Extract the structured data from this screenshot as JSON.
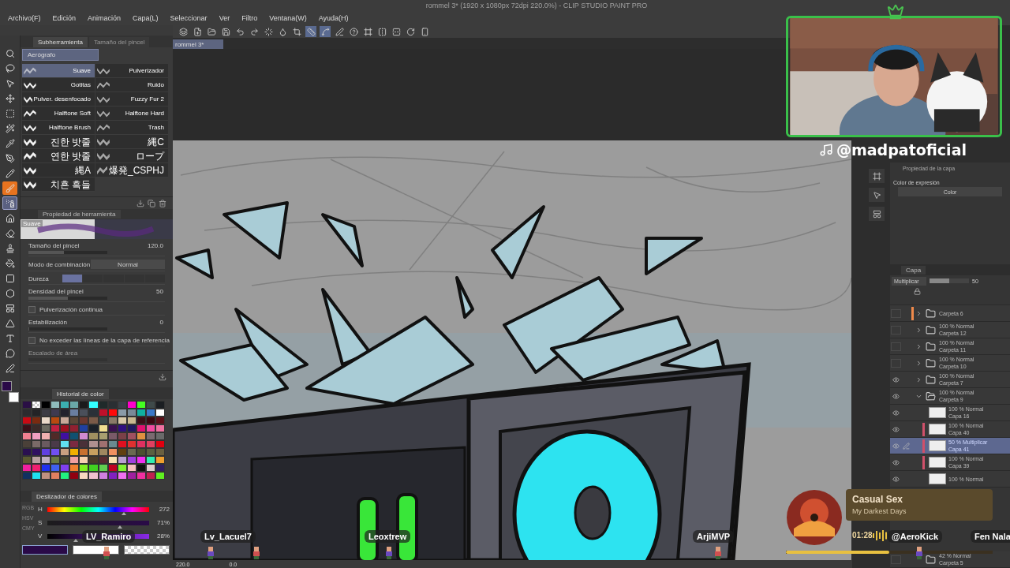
{
  "window": {
    "title": "rommel 3* (1920 x 1080px 72dpi 220.0%) - CLIP STUDIO PAINT PRO"
  },
  "menu": [
    "Archivo(F)",
    "Edición",
    "Animación",
    "Capa(L)",
    "Seleccionar",
    "Ver",
    "Filtro",
    "Ventana(W)",
    "Ayuda(H)"
  ],
  "command_bar": [
    {
      "kind": "app",
      "on": false
    },
    {
      "kind": "new",
      "on": false
    },
    {
      "kind": "open",
      "on": false
    },
    {
      "kind": "save",
      "on": false
    },
    {
      "kind": "undo",
      "on": false
    },
    {
      "kind": "redo",
      "on": false
    },
    {
      "kind": "loading",
      "on": false
    },
    {
      "kind": "fill",
      "on": false
    },
    {
      "kind": "crop",
      "on": false
    },
    {
      "kind": "ruler",
      "on": true
    },
    {
      "kind": "curve",
      "on": true
    },
    {
      "kind": "pen",
      "on": false
    },
    {
      "kind": "help",
      "on": false
    },
    {
      "kind": "frame",
      "on": false
    },
    {
      "kind": "flip",
      "on": false
    },
    {
      "kind": "flipv",
      "on": false
    },
    {
      "kind": "rotate",
      "on": false
    },
    {
      "kind": "phone",
      "on": false
    }
  ],
  "document_tab": {
    "label": "rommel 3*"
  },
  "tools": [
    {
      "kind": "search",
      "selected": false,
      "active": false
    },
    {
      "kind": "lasso",
      "selected": false,
      "active": false
    },
    {
      "kind": "pointer",
      "selected": false,
      "active": false
    },
    {
      "kind": "move",
      "selected": false,
      "active": false
    },
    {
      "kind": "select",
      "selected": false,
      "active": false
    },
    {
      "kind": "wand",
      "selected": false,
      "active": false
    },
    {
      "kind": "pipette",
      "selected": false,
      "active": false
    },
    {
      "kind": "pen",
      "selected": false,
      "active": false
    },
    {
      "kind": "pencil",
      "selected": false,
      "active": false
    },
    {
      "kind": "brush",
      "selected": false,
      "active": true
    },
    {
      "kind": "spray",
      "selected": true,
      "active": false
    },
    {
      "kind": "home",
      "selected": false,
      "active": false
    },
    {
      "kind": "eraser",
      "selected": false,
      "active": false
    },
    {
      "kind": "stamp",
      "selected": false,
      "active": false
    },
    {
      "kind": "bucket",
      "selected": false,
      "active": false
    },
    {
      "kind": "gradient",
      "selected": false,
      "active": false
    },
    {
      "kind": "shape",
      "selected": false,
      "active": false
    },
    {
      "kind": "panel",
      "selected": false,
      "active": false
    },
    {
      "kind": "ruler",
      "selected": false,
      "active": false
    },
    {
      "kind": "text",
      "selected": false,
      "active": false
    },
    {
      "kind": "balloon",
      "selected": false,
      "active": false
    },
    {
      "kind": "line",
      "selected": false,
      "active": false
    }
  ],
  "tool_colors": [
    {
      "kind": "main",
      "color": "#2a0a48"
    },
    {
      "kind": "sub",
      "color": "#ffffff"
    }
  ],
  "subtool_panel": {
    "tabs": [
      {
        "label": "Subherramienta",
        "selected": true
      },
      {
        "label": "Tamaño del pincel",
        "selected": false
      }
    ],
    "group": "Aerógrafo",
    "brushes": [
      {
        "label": "Suave",
        "selected": true
      },
      {
        "label": "Pulverizador",
        "selected": false
      },
      {
        "label": "Gotitas",
        "selected": false
      },
      {
        "label": "Ruido",
        "selected": false
      },
      {
        "label": "Pulver. desenfocado",
        "selected": false
      },
      {
        "label": "Fuzzy Fur 2",
        "selected": false
      },
      {
        "label": "Halftone Soft",
        "selected": false
      },
      {
        "label": "Halftone Hard",
        "selected": false
      },
      {
        "label": "Halftone Brush",
        "selected": false
      },
      {
        "label": "Trash",
        "selected": false
      },
      {
        "label": "진한 밧줄",
        "selected": false
      },
      {
        "label": "縄C",
        "selected": false
      },
      {
        "label": "연한 밧줄",
        "selected": false
      },
      {
        "label": "ロープ",
        "selected": false
      },
      {
        "label": "縄A",
        "selected": false
      },
      {
        "label": "爆発_CSPHJ",
        "selected": false
      },
      {
        "label": "치흔 흑들",
        "selected": false
      }
    ]
  },
  "tool_property": {
    "title": "Propiedad de herramienta",
    "preview_label": "Suave",
    "rows": [
      {
        "kind": "slider",
        "label": "Tamaño del pincel",
        "value": "120.0",
        "level": 0.45
      },
      {
        "kind": "select",
        "label": "Modo de combinación",
        "value": "Normal"
      },
      {
        "kind": "segments",
        "label": "Dureza",
        "level": 0.2
      },
      {
        "kind": "slider",
        "label": "Densidad del pincel",
        "value": "50",
        "level": 0.5
      },
      {
        "kind": "checkbox",
        "label": "Pulverización continua",
        "checked": false
      },
      {
        "kind": "slider",
        "label": "Estabilización",
        "value": "0",
        "level": 0
      },
      {
        "kind": "checkbox",
        "label": "No exceder las líneas de la capa de referencia",
        "checked": false
      },
      {
        "kind": "disabled",
        "label": "Escalado de área"
      }
    ]
  },
  "color_history": {
    "title": "Historial de color",
    "rows": [
      [
        {
          "kind": "solid",
          "color": "#2a0f45"
        },
        {
          "kind": "transparent"
        },
        {
          "kind": "solid",
          "color": "#000000"
        },
        {
          "kind": "solid",
          "color": "#8fbcbc"
        },
        {
          "kind": "solid",
          "color": "#3bb0b0"
        },
        {
          "kind": "solid",
          "color": "#6aa8a8"
        },
        {
          "kind": "solid",
          "color": "#1b1b1b"
        },
        {
          "kind": "solid",
          "color": "#33ffff"
        },
        {
          "kind": "solid",
          "color": "#1f2a2a"
        },
        {
          "kind": "solid",
          "color": "#2a2f33"
        },
        {
          "kind": "solid",
          "color": "#3a4048"
        },
        {
          "kind": "solid",
          "color": "#ff00cc"
        },
        {
          "kind": "solid",
          "color": "#44ff22"
        },
        {
          "kind": "solid",
          "color": "#3f4a4a"
        },
        {
          "kind": "solid",
          "color": "#1b1e22"
        }
      ],
      [
        {
          "kind": "solid",
          "color": "#2b2b2e"
        },
        {
          "kind": "solid",
          "color": "#232326"
        },
        {
          "kind": "solid",
          "color": "#3c3c44"
        },
        {
          "kind": "solid",
          "color": "#3f3a50"
        },
        {
          "kind": "solid",
          "color": "#22222c"
        },
        {
          "kind": "solid",
          "color": "#6a7fa0"
        },
        {
          "kind": "solid",
          "color": "#4a4f5a"
        },
        {
          "kind": "solid",
          "color": "#2a3038"
        },
        {
          "kind": "solid",
          "color": "#c0102a"
        },
        {
          "kind": "solid",
          "color": "#ff0a0a"
        },
        {
          "kind": "solid",
          "color": "#8a9aa8"
        },
        {
          "kind": "solid",
          "color": "#7a8a98"
        },
        {
          "kind": "solid",
          "color": "#10b0a0"
        },
        {
          "kind": "solid",
          "color": "#3a78c8"
        },
        {
          "kind": "solid",
          "color": "#ffffff"
        }
      ],
      [
        {
          "kind": "solid",
          "color": "#c80a14"
        },
        {
          "kind": "solid",
          "color": "#7a2a10"
        },
        {
          "kind": "solid",
          "color": "#e8d8c8"
        },
        {
          "kind": "solid",
          "color": "#b84a10"
        },
        {
          "kind": "solid",
          "color": "#c8a898"
        },
        {
          "kind": "solid",
          "color": "#5a4838"
        },
        {
          "kind": "solid",
          "color": "#6a3830"
        },
        {
          "kind": "solid",
          "color": "#7a5a48"
        },
        {
          "kind": "solid",
          "color": "#3a4a48"
        },
        {
          "kind": "solid",
          "color": "#8a7a68"
        },
        {
          "kind": "solid",
          "color": "#d8c8a8"
        },
        {
          "kind": "solid",
          "color": "#c8b890"
        },
        {
          "kind": "solid",
          "color": "#3a1018"
        },
        {
          "kind": "solid",
          "color": "#3a0810"
        },
        {
          "kind": "solid",
          "color": "#5a1018"
        }
      ],
      [
        {
          "kind": "solid",
          "color": "#3a1018"
        },
        {
          "kind": "solid",
          "color": "#3a2a28"
        },
        {
          "kind": "solid",
          "color": "#6a6a60"
        },
        {
          "kind": "solid",
          "color": "#c02040"
        },
        {
          "kind": "solid",
          "color": "#a01020"
        },
        {
          "kind": "solid",
          "color": "#902030"
        },
        {
          "kind": "solid",
          "color": "#2040a0"
        },
        {
          "kind": "solid",
          "color": "#1a2028"
        },
        {
          "kind": "solid",
          "color": "#f0e090"
        },
        {
          "kind": "solid",
          "color": "#3a1050"
        },
        {
          "kind": "solid",
          "color": "#301080"
        },
        {
          "kind": "solid",
          "color": "#201860"
        },
        {
          "kind": "solid",
          "color": "#e01070"
        },
        {
          "kind": "solid",
          "color": "#f04aa0"
        },
        {
          "kind": "solid",
          "color": "#f070a0"
        }
      ],
      [
        {
          "kind": "solid",
          "color": "#f08090"
        },
        {
          "kind": "solid",
          "color": "#f0a0c0"
        },
        {
          "kind": "solid",
          "color": "#f0b0b0"
        },
        {
          "kind": "solid",
          "color": "#502a28"
        },
        {
          "kind": "solid",
          "color": "#4010a0"
        },
        {
          "kind": "solid",
          "color": "#105070"
        },
        {
          "kind": "solid",
          "color": "#d08ad0"
        },
        {
          "kind": "solid",
          "color": "#a09060"
        },
        {
          "kind": "solid",
          "color": "#a8a070"
        },
        {
          "kind": "solid",
          "color": "#7a5a68"
        },
        {
          "kind": "solid",
          "color": "#7a4048"
        },
        {
          "kind": "solid",
          "color": "#a05060"
        },
        {
          "kind": "solid",
          "color": "#e09040"
        },
        {
          "kind": "solid",
          "color": "#7a6a70"
        },
        {
          "kind": "solid",
          "color": "#6a6a6a"
        }
      ],
      [
        {
          "kind": "solid",
          "color": "#4a4038"
        },
        {
          "kind": "solid",
          "color": "#7a6a68"
        },
        {
          "kind": "solid",
          "color": "#6a5a60"
        },
        {
          "kind": "solid",
          "color": "#4a3a48"
        },
        {
          "kind": "solid",
          "color": "#60e0f0"
        },
        {
          "kind": "solid",
          "color": "#7a2a40"
        },
        {
          "kind": "solid",
          "color": "#4a3038"
        },
        {
          "kind": "solid",
          "color": "#b09090"
        },
        {
          "kind": "solid",
          "color": "#a07070"
        },
        {
          "kind": "solid",
          "color": "#6a8a90"
        },
        {
          "kind": "solid",
          "color": "#e01020"
        },
        {
          "kind": "solid",
          "color": "#e03030"
        },
        {
          "kind": "solid",
          "color": "#e03060"
        },
        {
          "kind": "solid",
          "color": "#e04060"
        },
        {
          "kind": "solid",
          "color": "#e00010"
        }
      ],
      [
        {
          "kind": "solid",
          "color": "#2a1050"
        },
        {
          "kind": "solid",
          "color": "#301060"
        },
        {
          "kind": "solid",
          "color": "#6040e0"
        },
        {
          "kind": "solid",
          "color": "#7050f0"
        },
        {
          "kind": "solid",
          "color": "#c8a080"
        },
        {
          "kind": "solid",
          "color": "#f0b000"
        },
        {
          "kind": "solid",
          "color": "#c87030"
        },
        {
          "kind": "solid",
          "color": "#c8a060"
        },
        {
          "kind": "solid",
          "color": "#a08860"
        },
        {
          "kind": "solid",
          "color": "#f09060"
        },
        {
          "kind": "solid",
          "color": "#604010"
        },
        {
          "kind": "solid",
          "color": "#6a6a50"
        },
        {
          "kind": "solid",
          "color": "#4a5030"
        },
        {
          "kind": "solid",
          "color": "#5a6040"
        },
        {
          "kind": "solid",
          "color": "#6a6040"
        }
      ],
      [
        {
          "kind": "solid",
          "color": "#5a5a30"
        },
        {
          "kind": "solid",
          "color": "#b8a0a0"
        },
        {
          "kind": "solid",
          "color": "#c0b0c0"
        },
        {
          "kind": "solid",
          "color": "#6a7a40"
        },
        {
          "kind": "solid",
          "color": "#4a4a30"
        },
        {
          "kind": "solid",
          "color": "#f0a0a0"
        },
        {
          "kind": "solid",
          "color": "#f8d0b0"
        },
        {
          "kind": "solid",
          "color": "#4a3a28"
        },
        {
          "kind": "solid",
          "color": "#5a2a30"
        },
        {
          "kind": "solid",
          "color": "#f8e0b0"
        },
        {
          "kind": "solid",
          "color": "#b8a0d0"
        },
        {
          "kind": "solid",
          "color": "#a040e0"
        },
        {
          "kind": "solid",
          "color": "#f030f0"
        },
        {
          "kind": "solid",
          "color": "#30f0b0"
        },
        {
          "kind": "solid",
          "color": "#f0a030"
        }
      ],
      [
        {
          "kind": "solid",
          "color": "#f020a0"
        },
        {
          "kind": "solid",
          "color": "#f02070"
        },
        {
          "kind": "solid",
          "color": "#2030f0"
        },
        {
          "kind": "solid",
          "color": "#4060f0"
        },
        {
          "kind": "solid",
          "color": "#8040f0"
        },
        {
          "kind": "solid",
          "color": "#f08030"
        },
        {
          "kind": "solid",
          "color": "#80f020"
        },
        {
          "kind": "solid",
          "color": "#40d020"
        },
        {
          "kind": "solid",
          "color": "#60d050"
        },
        {
          "kind": "solid",
          "color": "#c00020"
        },
        {
          "kind": "solid",
          "color": "#80f030"
        },
        {
          "kind": "solid",
          "color": "#f8c0c0"
        },
        {
          "kind": "solid",
          "color": "#101010"
        },
        {
          "kind": "solid",
          "color": "#e0d0d0"
        },
        {
          "kind": "solid",
          "color": "#302060"
        }
      ],
      [
        {
          "kind": "solid",
          "color": "#103060"
        },
        {
          "kind": "solid",
          "color": "#20e0f0"
        },
        {
          "kind": "solid",
          "color": "#c09080"
        },
        {
          "kind": "solid",
          "color": "#e08060"
        },
        {
          "kind": "solid",
          "color": "#20f080"
        },
        {
          "kind": "solid",
          "color": "#900010"
        },
        {
          "kind": "solid",
          "color": "#f8d8c0"
        },
        {
          "kind": "solid",
          "color": "#f0c0d0"
        },
        {
          "kind": "solid",
          "color": "#d080e0"
        },
        {
          "kind": "solid",
          "color": "#8020c0"
        },
        {
          "kind": "solid",
          "color": "#f070f0"
        },
        {
          "kind": "solid",
          "color": "#a020a0"
        },
        {
          "kind": "solid",
          "color": "#f030a0"
        },
        {
          "kind": "solid",
          "color": "#c02050"
        },
        {
          "kind": "solid",
          "color": "#60f020"
        }
      ]
    ]
  },
  "color_slider": {
    "title": "Deslizador de colores",
    "modes": [
      "RGB",
      "HSV",
      "CMY"
    ],
    "channels": [
      {
        "kind": "hue",
        "label": "H",
        "value": "272",
        "level": 0.75
      },
      {
        "kind": "saturation",
        "label": "S",
        "value": "71%",
        "level": 0.71
      },
      {
        "kind": "value",
        "label": "V",
        "value": "28%",
        "level": 0.28
      }
    ],
    "boxes": [
      {
        "kind": "main",
        "color": "#2a0a48"
      },
      {
        "kind": "sub",
        "color": "#ffffff"
      }
    ]
  },
  "layer_property": {
    "title": "Propiedad de la capa",
    "expression_label": "Color de expresión",
    "expression_value": "Color"
  },
  "layers_panel": {
    "title": "Capa",
    "blend": "Multiplicar",
    "opacity": "50",
    "level": 0.5,
    "layers": [
      {
        "kind": "folder",
        "name": "Carpeta 6",
        "visible": false,
        "expanded": false,
        "selected": false,
        "color": "#f08a4b"
      },
      {
        "kind": "folder",
        "blend": "100 % Normal",
        "name": "Carpeta 12",
        "visible": false,
        "expanded": false,
        "selected": false
      },
      {
        "kind": "folder",
        "blend": "100 % Normal",
        "name": "Carpeta 11",
        "visible": false,
        "expanded": false,
        "selected": false
      },
      {
        "kind": "folder",
        "blend": "100 % Normal",
        "name": "Carpeta 10",
        "visible": false,
        "expanded": false,
        "selected": false
      },
      {
        "kind": "folder",
        "blend": "100 % Normal",
        "name": "Carpeta 7",
        "visible": true,
        "expanded": false,
        "selected": false
      },
      {
        "kind": "folder",
        "blend": "100 % Normal",
        "name": "Carpeta 9",
        "visible": true,
        "expanded": true,
        "selected": false,
        "children": [
          {
            "kind": "layer",
            "blend": "100 % Normal",
            "name": "Capa 16",
            "visible": true,
            "selected": false
          },
          {
            "kind": "layer",
            "blend": "100 % Normal",
            "name": "Capa 40",
            "visible": true,
            "selected": false,
            "color": "#d0506a"
          },
          {
            "kind": "layer",
            "blend": "50 % Multiplicar",
            "name": "Capa 41",
            "visible": true,
            "selected": true,
            "color": "#d0506a"
          },
          {
            "kind": "layer",
            "blend": "100 % Normal",
            "name": "Capa 39",
            "visible": true,
            "selected": false,
            "color": "#d0506a"
          },
          {
            "kind": "layer",
            "blend": "100 % Normal",
            "visible": true,
            "selected": false
          }
        ]
      }
    ],
    "bottom_layer": {
      "kind": "folder",
      "blend": "42 % Normal",
      "name": "Carpeta 5",
      "visible": false,
      "selected": false
    }
  },
  "status_bar": {
    "zoom": "220.0",
    "angle": "0.0"
  },
  "stream_overlay": {
    "handle": "@madpatoficial",
    "now_playing": {
      "title": "Casual Sex",
      "artist": "My Darkest Days",
      "time": "01:28",
      "level": 0.5
    },
    "chat_names": [
      {
        "name": "LV_Ramiro"
      },
      {
        "name": "Lv_Lacuel7"
      },
      {
        "name": "Leoxtrew"
      },
      {
        "name": "ArjiMVP"
      },
      {
        "name": "@AeroKick"
      },
      {
        "name": "Fen Nala"
      }
    ]
  }
}
